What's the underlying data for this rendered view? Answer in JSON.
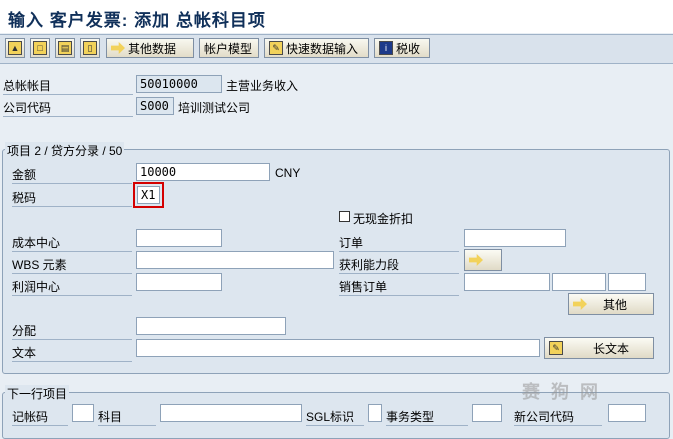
{
  "title": "输入 客户发票: 添加 总帐科目项",
  "toolbar": {
    "other_data": "其他数据",
    "account_model": "帐户模型",
    "fast_entry": "快速数据输入",
    "tax": "税收"
  },
  "header": {
    "gl_account_label": "总帐帐目",
    "gl_account_value": "50010000",
    "gl_account_desc": "主营业务收入",
    "company_code_label": "公司代码",
    "company_code_value": "S000",
    "company_code_desc": "培训测试公司"
  },
  "item": {
    "group_title": "项目 2 / 贷方分录 / 50",
    "amount_label": "金额",
    "amount_value": "10000",
    "currency": "CNY",
    "tax_code_label": "税码",
    "tax_code_value": "X1",
    "no_discount_label": "无现金折扣",
    "cost_center_label": "成本中心",
    "order_label": "订单",
    "wbs_label": "WBS 元素",
    "profitability_label": "获利能力段",
    "profit_center_label": "利润中心",
    "sales_order_label": "销售订单",
    "more_label": "其他",
    "assignment_label": "分配",
    "text_label": "文本",
    "long_text_label": "长文本"
  },
  "next_item": {
    "group_title": "下一行项目",
    "posting_key_label": "记帐码",
    "account_label": "科目",
    "sgl_label": "SGL标识",
    "trans_type_label": "事务类型",
    "new_company_code_label": "新公司代码"
  },
  "watermark": "赛 狗 网"
}
